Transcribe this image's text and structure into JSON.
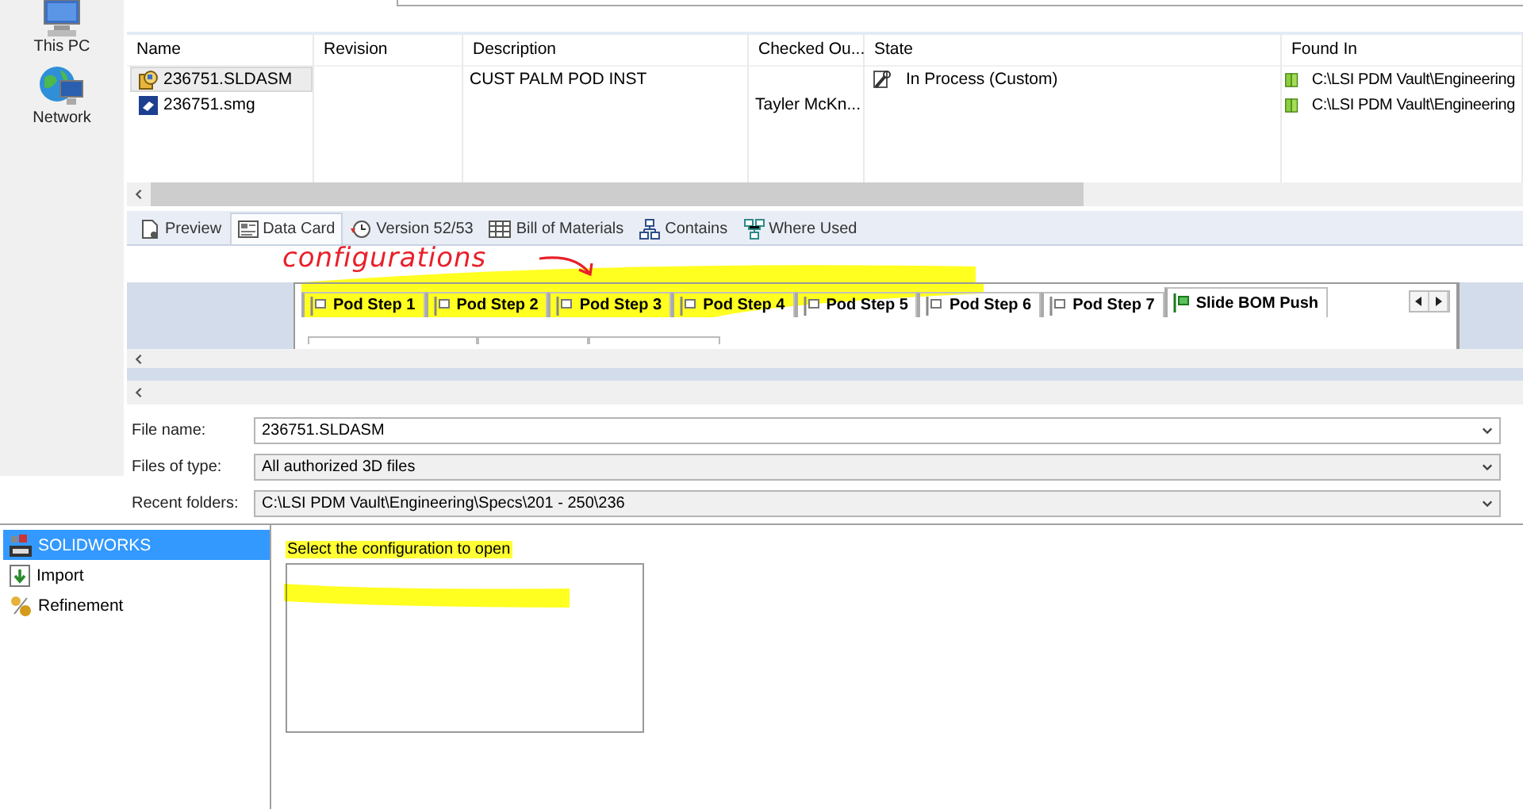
{
  "nav": [
    {
      "label": "This PC"
    },
    {
      "label": "Network"
    }
  ],
  "file_list": {
    "columns": [
      "Name",
      "Revision",
      "Description",
      "Checked Ou...",
      "State",
      "Found In"
    ],
    "rows": [
      {
        "name": "236751.SLDASM",
        "kind": "assembly",
        "selected": true,
        "description": "CUST PALM POD INST",
        "state": "In Process (Custom)",
        "found_in": "C:\\LSI PDM Vault\\Engineering"
      },
      {
        "name": "236751.smg",
        "kind": "smg",
        "selected": false,
        "checked_out_by": "Tayler McKn...",
        "found_in": "C:\\LSI PDM Vault\\Engineering"
      }
    ]
  },
  "view_tabs": [
    {
      "label": "Preview",
      "selected": false
    },
    {
      "label": "Data Card",
      "selected": true
    },
    {
      "label": "Version 52/53",
      "selected": false
    },
    {
      "label": "Bill of Materials",
      "selected": false
    },
    {
      "label": "Contains",
      "selected": false
    },
    {
      "label": "Where Used",
      "selected": false
    }
  ],
  "annotation": {
    "text": "configurations"
  },
  "config_tabs": [
    {
      "label": "Pod Step 1",
      "selected": false
    },
    {
      "label": "Pod Step 2",
      "selected": false
    },
    {
      "label": "Pod Step 3",
      "selected": false
    },
    {
      "label": "Pod Step 4",
      "selected": false
    },
    {
      "label": "Pod Step 5",
      "selected": false
    },
    {
      "label": "Pod Step 6",
      "selected": false
    },
    {
      "label": "Pod Step 7",
      "selected": false
    },
    {
      "label": "Slide BOM Push",
      "selected": true
    }
  ],
  "form": [
    {
      "label": "File name:",
      "value": "236751.SLDASM",
      "kind": "combo"
    },
    {
      "label": "Files of type:",
      "value": "All authorized 3D files",
      "kind": "list"
    },
    {
      "label": "Recent folders:",
      "value": "C:\\LSI PDM Vault\\Engineering\\Specs\\201 - 250\\236",
      "kind": "list"
    }
  ],
  "options": [
    {
      "label": "SOLIDWORKS",
      "selected": true
    },
    {
      "label": "Import",
      "selected": false
    },
    {
      "label": "Refinement",
      "selected": false
    }
  ],
  "config_prompt": "Select the configuration to open"
}
